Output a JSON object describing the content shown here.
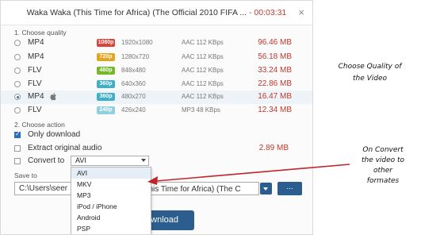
{
  "dialog": {
    "title": "Waka Waka (This Time for Africa) (The Official 2010 FIFA ... ",
    "time": "- 00:03:31",
    "close_icon": "×",
    "section_quality": "1. Choose quality",
    "section_action": "2. Choose action",
    "save_label": "Save to"
  },
  "quality_rows": [
    {
      "format": "MP4",
      "badge": "1080p",
      "badge_color": "#d9453a",
      "resolution": "1920x1080",
      "audio": "AAC 112 KBps",
      "size": "96.46 MB",
      "selected": false,
      "apple": false
    },
    {
      "format": "MP4",
      "badge": "720p",
      "badge_color": "#e2a51c",
      "resolution": "1280x720",
      "audio": "AAC 112 KBps",
      "size": "56.18 MB",
      "selected": false,
      "apple": false
    },
    {
      "format": "FLV",
      "badge": "480p",
      "badge_color": "#76b82a",
      "resolution": "848x480",
      "audio": "AAC 112 KBps",
      "size": "33.24 MB",
      "selected": false,
      "apple": false
    },
    {
      "format": "FLV",
      "badge": "360p",
      "badge_color": "#3db0c8",
      "resolution": "640x360",
      "audio": "AAC 112 KBps",
      "size": "22.86 MB",
      "selected": false,
      "apple": false
    },
    {
      "format": "MP4",
      "badge": "360p",
      "badge_color": "#3db0c8",
      "resolution": "480x270",
      "audio": "AAC 112 KBps",
      "size": "16.47 MB",
      "selected": true,
      "apple": true
    },
    {
      "format": "FLV",
      "badge": "240p",
      "badge_color": "#8fcfe0",
      "resolution": "426x240",
      "audio": "MP3 48 KBps",
      "size": "12.34 MB",
      "selected": false,
      "apple": false
    }
  ],
  "actions": {
    "only_download": "Only download",
    "extract_audio": "Extract original audio",
    "extract_size": "2.89 MB",
    "convert_to": "Convert to",
    "convert_value": "AVI"
  },
  "dropdown_items": [
    "AVI",
    "MKV",
    "MP3",
    "iPod / iPhone",
    "Android",
    "PSP"
  ],
  "path": {
    "left": "C:\\Users\\seer",
    "right": "(This Time for Africa) (The C",
    "browse": "..."
  },
  "download_label": "wnload",
  "annotations": {
    "quality": [
      "Choose Quality of",
      "the Video"
    ],
    "convert": [
      "On Convert",
      "the video to",
      "other",
      "formates"
    ]
  }
}
